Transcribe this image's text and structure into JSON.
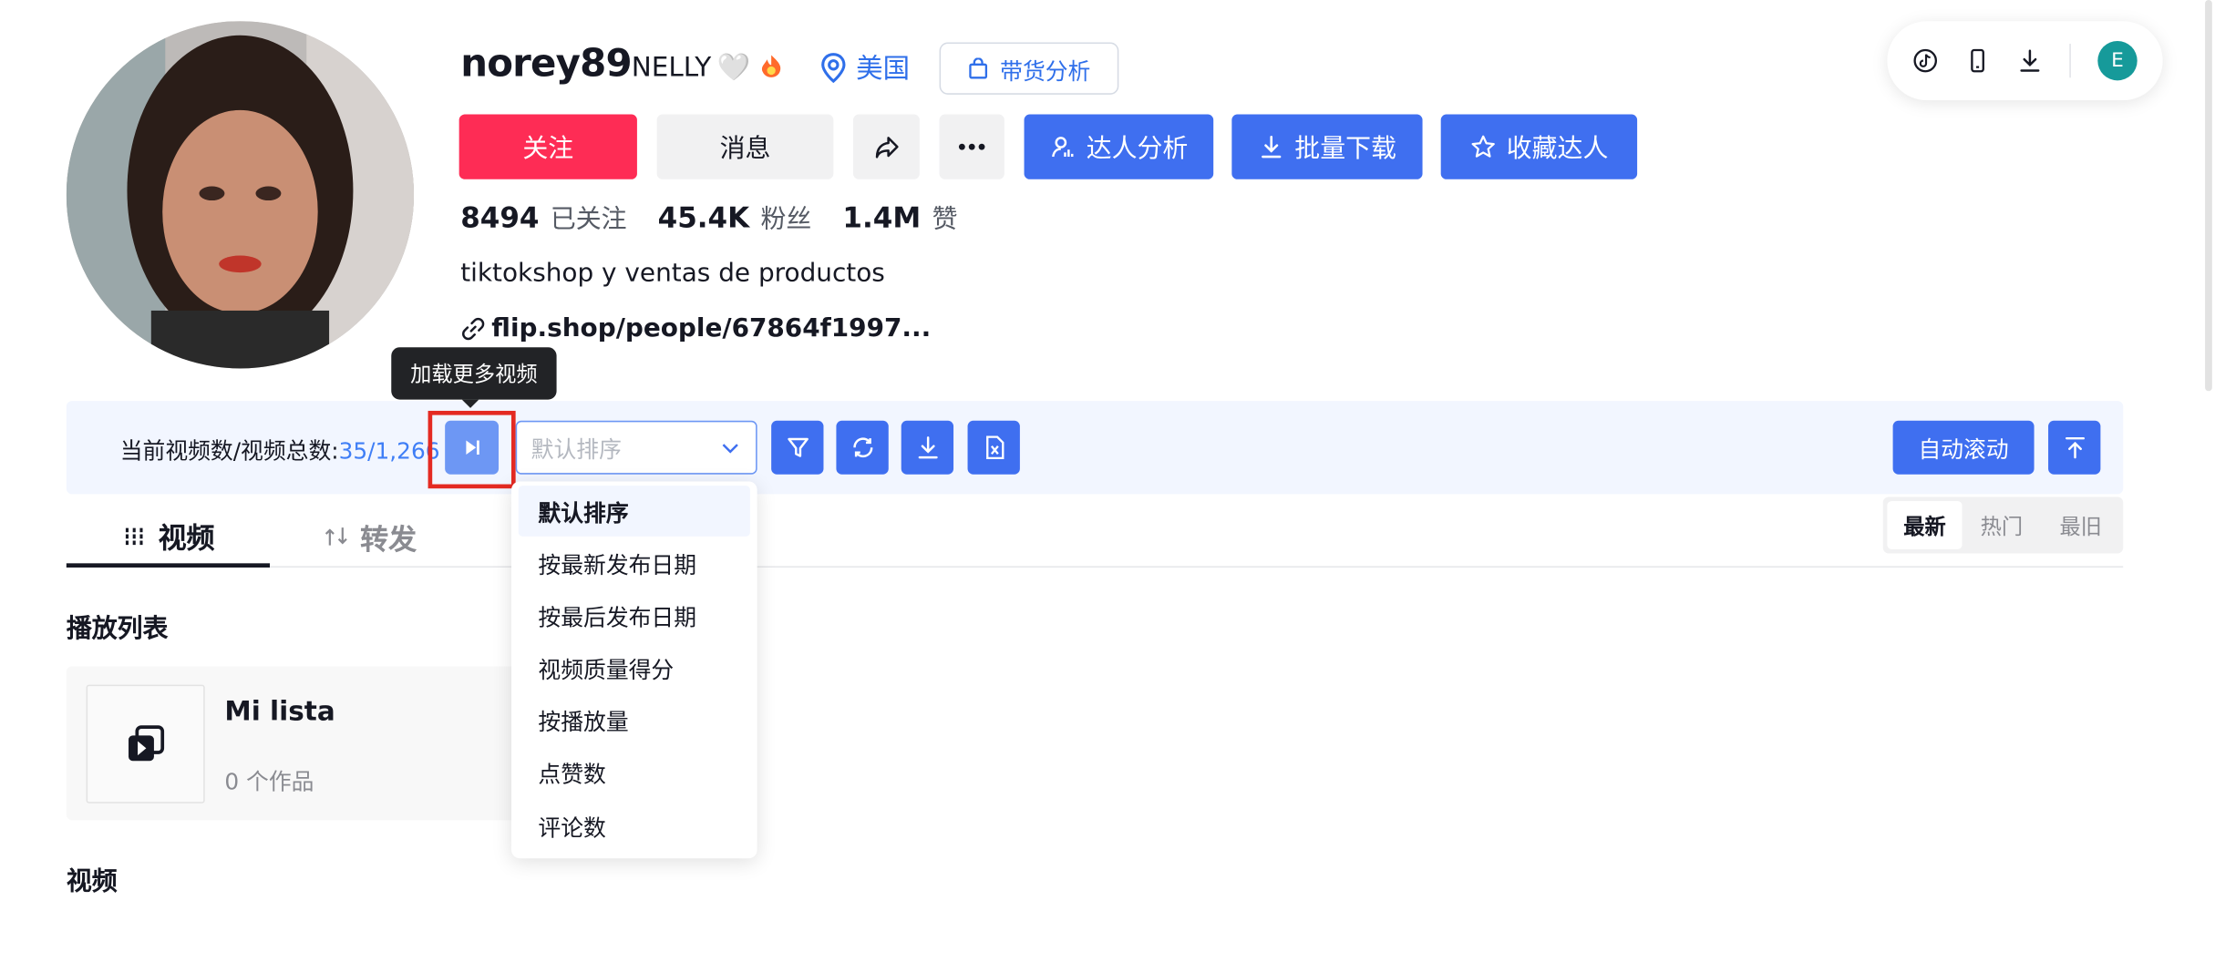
{
  "profile": {
    "username": "norey89",
    "nickname": "NELLY",
    "nickname_emoji": "🤍",
    "region": "美国",
    "shop_analysis": "带货分析",
    "bio": "tiktokshop y ventas de productos",
    "link": "flip.shop/people/67864f1997..."
  },
  "actions": {
    "follow": "关注",
    "message": "消息",
    "creator_analysis": "达人分析",
    "batch_download": "批量下载",
    "favorite_creator": "收藏达人"
  },
  "stats": {
    "following_value": "8494",
    "following_label": "已关注",
    "followers_value": "45.4K",
    "followers_label": "粉丝",
    "likes_value": "1.4M",
    "likes_label": "赞"
  },
  "topbar": {
    "icons": [
      "tiktok-icon",
      "mobile-icon",
      "download-icon"
    ],
    "avatar_letter": "E"
  },
  "toolbar": {
    "tooltip": "加载更多视频",
    "counter_label": "当前视频数/视频总数:",
    "counter_value": "35/1,266",
    "sort_placeholder": "默认排序",
    "auto_scroll": "自动滚动"
  },
  "tabs": {
    "videos": "视频",
    "reposts": "转发"
  },
  "sort_segment": {
    "newest": "最新",
    "popular": "热门",
    "oldest": "最旧"
  },
  "playlist_section": {
    "title": "播放列表",
    "name": "Mi lista",
    "count": "0 个作品"
  },
  "videos_section": {
    "title": "视频"
  },
  "sort_menu": {
    "items": [
      "默认排序",
      "按最新发布日期",
      "按最后发布日期",
      "视频质量得分",
      "按播放量",
      "点赞数",
      "评论数"
    ],
    "selected": "默认排序"
  },
  "colors": {
    "follow_red": "#fe2c55",
    "primary_blue": "#3f6ff0",
    "link_blue": "#2f6fea",
    "highlight_red": "#e42a22"
  }
}
